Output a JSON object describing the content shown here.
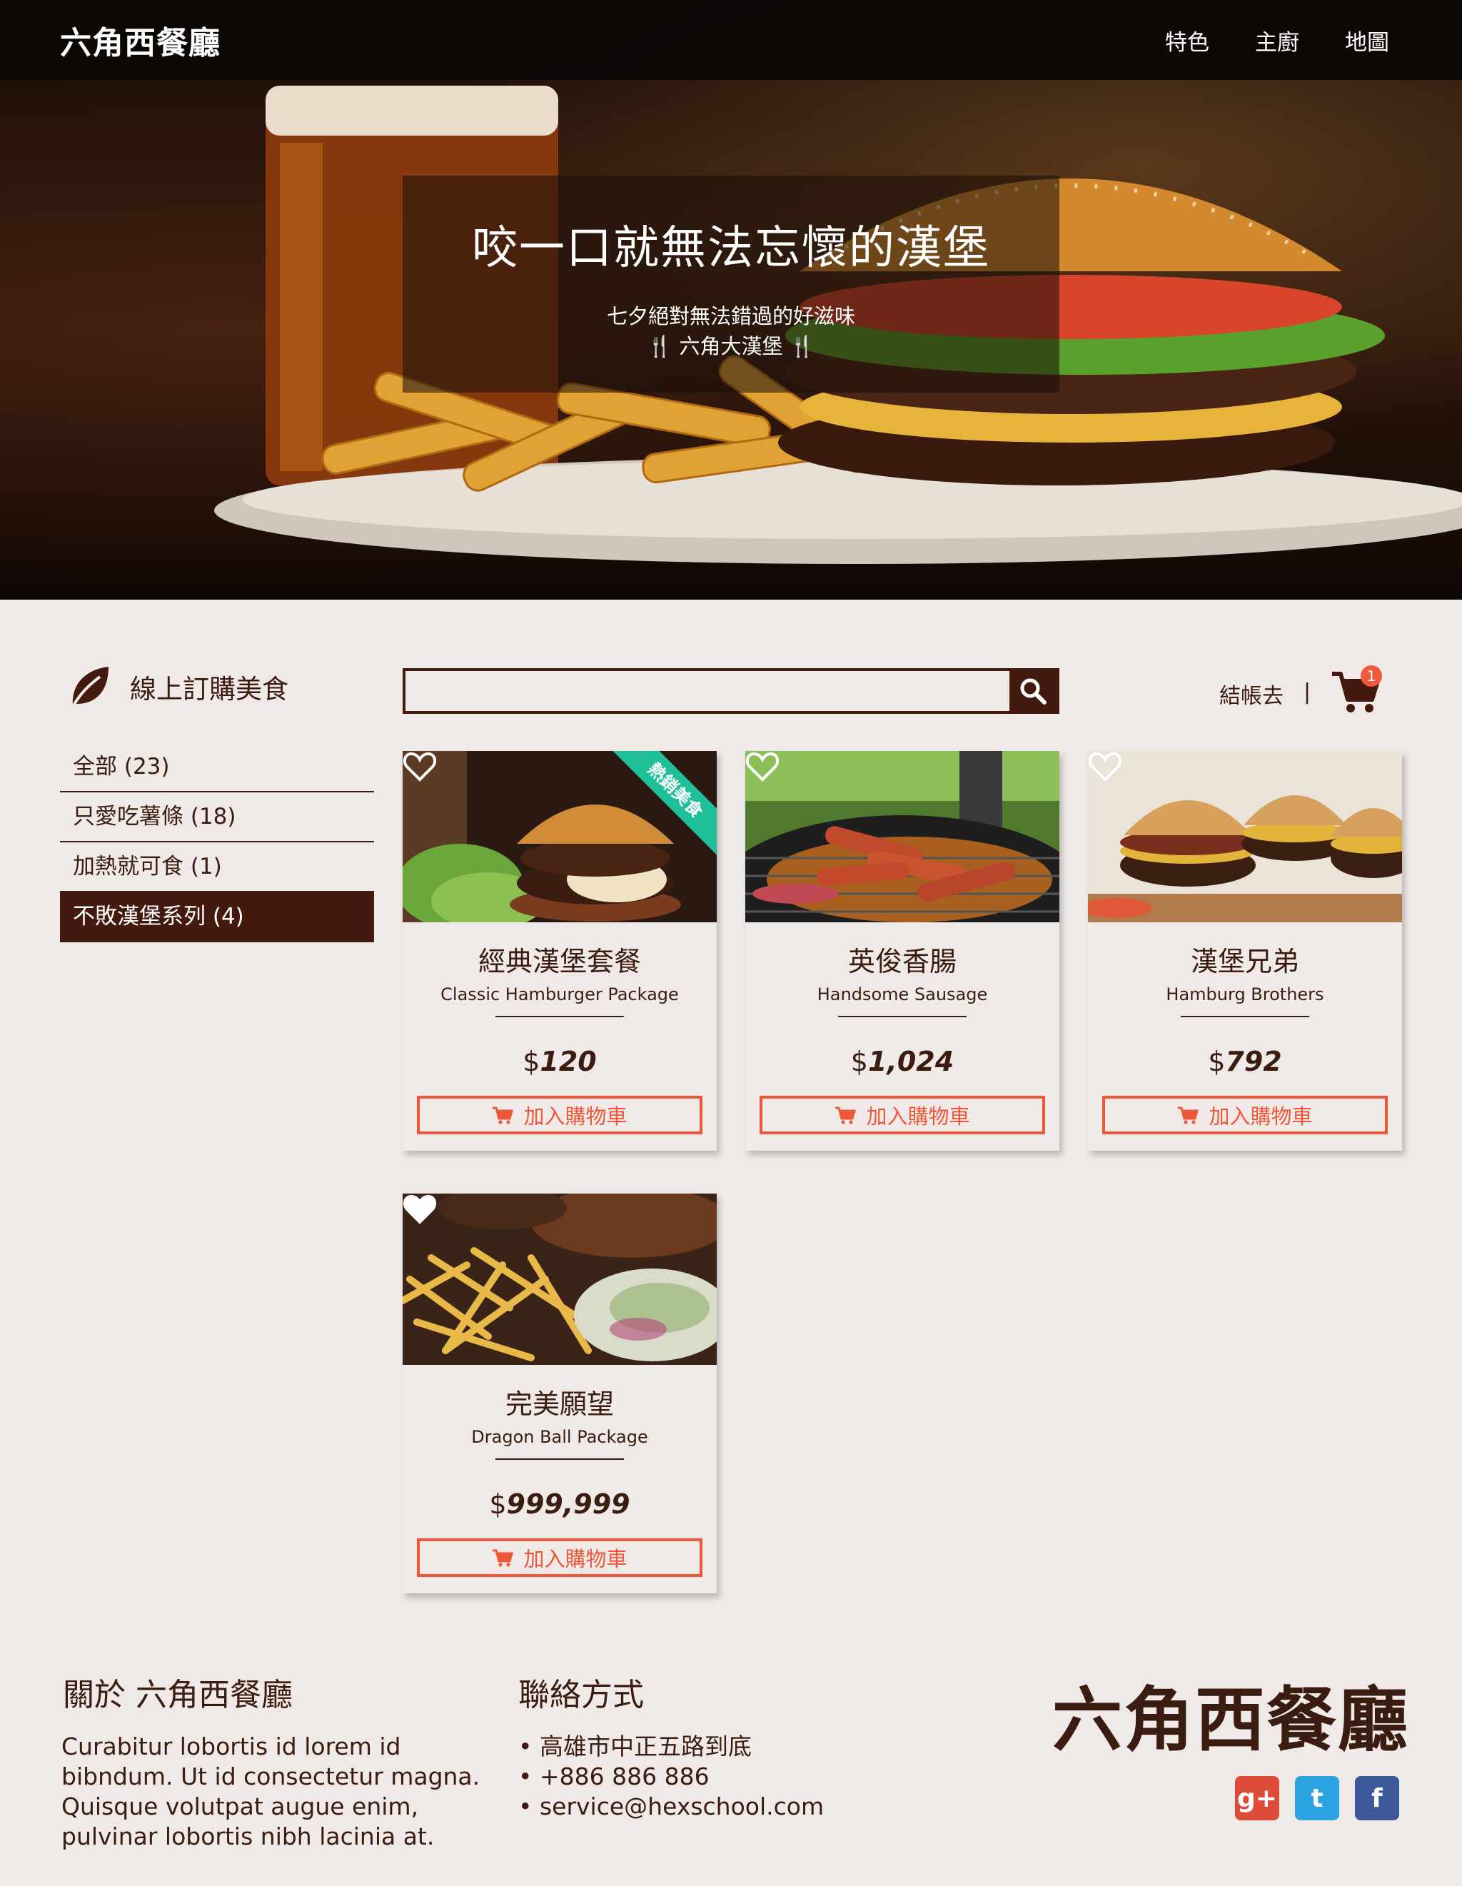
{
  "nav": {
    "brand": "六角西餐廳",
    "links": [
      "特色",
      "主廚",
      "地圖"
    ]
  },
  "hero": {
    "title": "咬一口就無法忘懷的漢堡",
    "subtitle": "七夕絕對無法錯過的好滋味",
    "tagline": "六角大漢堡",
    "fork_icon": "🍴"
  },
  "sidebar": {
    "title": "線上訂購美食",
    "categories": [
      {
        "label": "全部 (23)",
        "active": false
      },
      {
        "label": "只愛吃薯條 (18)",
        "active": false
      },
      {
        "label": "加熱就可食 (1)",
        "active": false
      },
      {
        "label": "不敗漢堡系列 (4)",
        "active": true
      }
    ]
  },
  "search": {
    "value": "",
    "placeholder": ""
  },
  "cart": {
    "checkout_label": "結帳去",
    "separator": "|",
    "count": "1"
  },
  "products": [
    {
      "name": "經典漢堡套餐",
      "en": "Classic Hamburger Package",
      "currency": "$",
      "price": "120",
      "liked": false,
      "ribbon": "熱銷美食",
      "button": "加入購物車"
    },
    {
      "name": "英俊香腸",
      "en": "Handsome Sausage",
      "currency": "$",
      "price": "1,024",
      "liked": false,
      "ribbon": "",
      "button": "加入購物車"
    },
    {
      "name": "漢堡兄弟",
      "en": "Hamburg Brothers",
      "currency": "$",
      "price": "792",
      "liked": false,
      "ribbon": "",
      "button": "加入購物車"
    },
    {
      "name": "完美願望",
      "en": "Dragon Ball Package",
      "currency": "$",
      "price": "999,999",
      "liked": true,
      "ribbon": "",
      "button": "加入購物車"
    }
  ],
  "footer": {
    "about_title": "關於 六角西餐廳",
    "about_text": "Curabitur lobortis id lorem id bibndum. Ut id consectetur magna. Quisque volutpat augue enim, pulvinar lobortis nibh lacinia at.",
    "contact_title": "聯絡方式",
    "contacts": [
      "高雄市中正五路到底",
      "+886 886 886",
      "service@hexschool.com"
    ],
    "brand": "六角西餐廳",
    "socials": [
      {
        "name": "google-plus",
        "glyph": "g+",
        "color": "#dd4b39"
      },
      {
        "name": "twitter",
        "glyph": "t",
        "color": "#2aa3e0"
      },
      {
        "name": "facebook",
        "glyph": "f",
        "color": "#3b5998"
      }
    ]
  },
  "colors": {
    "primary": "#451a0e",
    "accent": "#ee5838",
    "ribbon": "#1fbf9a",
    "background": "#efe9e7"
  }
}
